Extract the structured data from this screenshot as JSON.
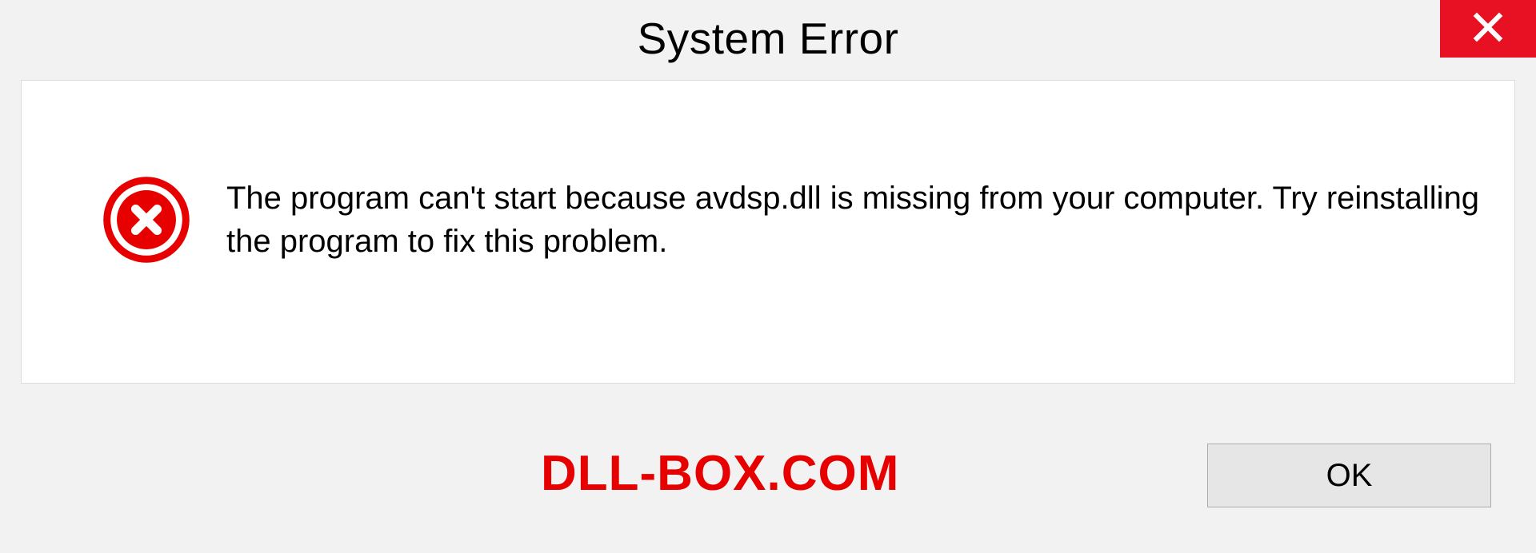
{
  "dialog": {
    "title": "System Error",
    "message": "The program can't start because avdsp.dll is missing from your computer. Try reinstalling the program to fix this problem.",
    "ok_label": "OK"
  },
  "watermark": "DLL-BOX.COM"
}
